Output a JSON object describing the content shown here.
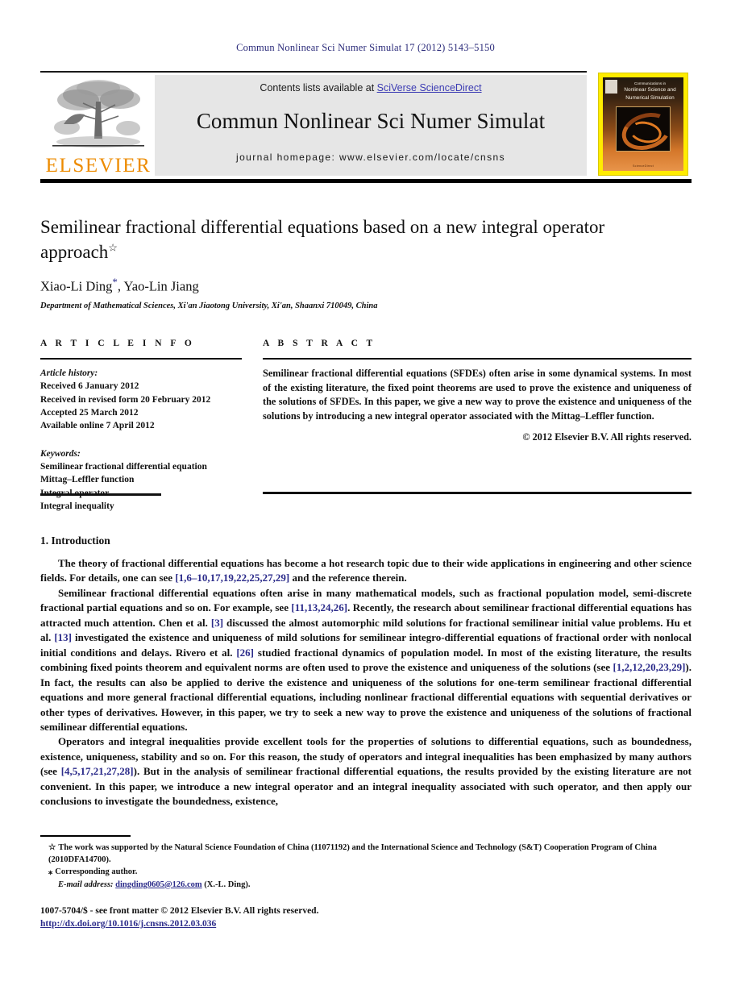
{
  "running_head": "Commun Nonlinear Sci Numer Simulat 17 (2012) 5143–5150",
  "header": {
    "publisher_name": "ELSEVIER",
    "contents_prefix": "Contents lists available at ",
    "contents_link": "SciVerse ScienceDirect",
    "journal_title": "Commun Nonlinear Sci Numer Simulat",
    "homepage": "journal homepage: www.elsevier.com/locate/cnsns",
    "cover": {
      "line1": "Communications in",
      "line2": "Nonlinear Science and",
      "line3": "Numerical Simulation",
      "footer": "ScienceDirect"
    }
  },
  "title": {
    "text": "Semilinear fractional differential equations based on a new integral operator approach",
    "star": "☆"
  },
  "authors": {
    "line": "Xiao-Li Ding",
    "corresponding_mark": "*",
    "line_rest": ", Yao-Lin Jiang",
    "affiliation": "Department of Mathematical Sciences, Xi'an Jiaotong University, Xi'an, Shaanxi 710049, China"
  },
  "article_info": {
    "heading": "A R T I C L E   I N F O",
    "history_label": "Article history:",
    "history": [
      "Received 6 January 2012",
      "Received in revised form 20 February 2012",
      "Accepted 25 March 2012",
      "Available online 7 April 2012"
    ],
    "keywords_label": "Keywords:",
    "keywords": [
      "Semilinear fractional differential equation",
      "Mittag–Leffler function",
      "Integral operator",
      "Integral inequality"
    ]
  },
  "abstract": {
    "heading": "A B S T R A C T",
    "text": "Semilinear fractional differential equations (SFDEs) often arise in some dynamical systems. In most of the existing literature, the fixed point theorems are used to prove the existence and uniqueness of the solutions of SFDEs. In this paper, we give a new way to prove the existence and uniqueness of the solutions by introducing a new integral operator associated with the Mittag–Leffler function.",
    "copyright": "© 2012 Elsevier B.V. All rights reserved."
  },
  "introduction": {
    "heading": "1. Introduction",
    "paragraphs": [
      {
        "segments": [
          {
            "t": "The theory of fractional differential equations has become a hot research topic due to their wide applications in engineering and other science fields. For details, one can see ",
            "k": "text"
          },
          {
            "t": "[1,6–10,17,19,22,25,27,29]",
            "k": "ref"
          },
          {
            "t": " and the reference therein.",
            "k": "text"
          }
        ]
      },
      {
        "segments": [
          {
            "t": "Semilinear fractional differential equations often arise in many mathematical models, such as fractional population model, semi-discrete fractional partial equations and so on. For example, see ",
            "k": "text"
          },
          {
            "t": "[11,13,24,26]",
            "k": "ref"
          },
          {
            "t": ". Recently, the research about semilinear fractional differential equations has attracted much attention. Chen et al. ",
            "k": "text"
          },
          {
            "t": "[3]",
            "k": "ref"
          },
          {
            "t": " discussed the almost automorphic mild solutions for fractional semilinear initial value problems. Hu et al. ",
            "k": "text"
          },
          {
            "t": "[13]",
            "k": "ref"
          },
          {
            "t": " investigated the existence and uniqueness of mild solutions for semilinear integro-differential equations of fractional order with nonlocal initial conditions and delays. Rivero et al. ",
            "k": "text"
          },
          {
            "t": "[26]",
            "k": "ref"
          },
          {
            "t": " studied fractional dynamics of population model. In most of the existing literature, the results combining fixed points theorem and equivalent norms are often used to prove the existence and uniqueness of the solutions (see ",
            "k": "text"
          },
          {
            "t": "[1,2,12,20,23,29]",
            "k": "ref"
          },
          {
            "t": "). In fact, the results can also be applied to derive the existence and uniqueness of the solutions for one-term semilinear fractional differential equations and more general fractional differential equations, including nonlinear fractional differential equations with sequential derivatives or other types of derivatives. However, in this paper, we try to seek a new way to prove the existence and uniqueness of the solutions of fractional semilinear differential equations.",
            "k": "text"
          }
        ]
      },
      {
        "segments": [
          {
            "t": "Operators and integral inequalities provide excellent tools for the properties of solutions to differential equations, such as boundedness, existence, uniqueness, stability and so on. For this reason, the study of operators and integral inequalities has been emphasized by many authors (see ",
            "k": "text"
          },
          {
            "t": "[4,5,17,21,27,28]",
            "k": "ref"
          },
          {
            "t": "). But in the analysis of semilinear fractional differential equations, the results provided by the existing literature are not convenient. In this paper, we introduce a new integral operator and an integral inequality associated with such operator, and then apply our conclusions to investigate the boundedness, existence,",
            "k": "text"
          }
        ]
      }
    ]
  },
  "footnotes": {
    "funding_mark": "☆",
    "funding": "The work was supported by the Natural Science Foundation of China (11071192) and the International Science and Technology (S&T) Cooperation Program of China (2010DFA14700).",
    "corresponding_mark": "⁎",
    "corresponding": "Corresponding author.",
    "email_label": "E-mail address:",
    "email": "dingding0605@126.com",
    "email_suffix": "(X.-L. Ding)."
  },
  "colophon": {
    "line1": "1007-5704/$ - see front matter © 2012 Elsevier B.V. All rights reserved.",
    "doi": "http://dx.doi.org/10.1016/j.cnsns.2012.03.036"
  },
  "colors": {
    "link": "#2b2b8a",
    "sciencedirect_link": "#3b3bb3",
    "elsevier_orange": "#ED8B00",
    "cover_border": "#FFEC00",
    "band_gray": "#e6e6e6",
    "running_head": "#2b2b7a"
  }
}
